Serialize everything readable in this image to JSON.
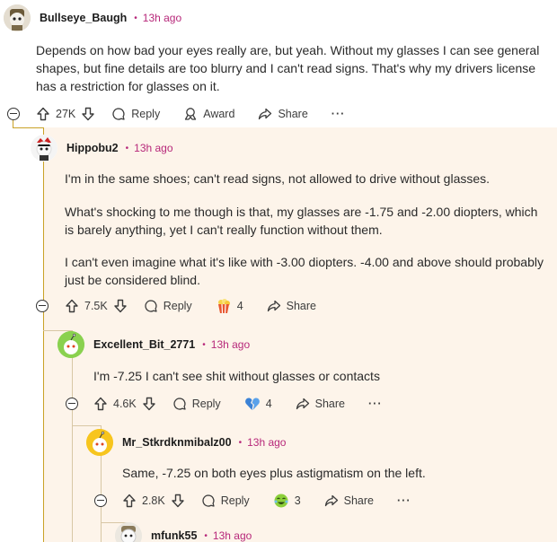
{
  "comments": [
    {
      "user": "Bullseye_Baugh",
      "time": "13h ago",
      "body": "Depends on how bad your eyes really are, but yeah. Without my glasses I can see general shapes, but fine details are too blurry and I can't read signs. That's why my drivers license has a restriction for glasses on it.",
      "votes": "27K",
      "reply_label": "Reply",
      "award_label": "Award",
      "share_label": "Share",
      "more_label": "···"
    },
    {
      "user": "Hippobu2",
      "time": "13h ago",
      "paragraphs": [
        "I'm in the same shoes; can't read signs, not allowed to drive without glasses.",
        "What's shocking to me though is that, my glasses are -1.75 and -2.00 diopters, which is barely anything, yet I can't really function without them.",
        "I can't even imagine what it's like with -3.00 diopters. -4.00 and above should probably just be considered blind."
      ],
      "votes": "7.5K",
      "reply_label": "Reply",
      "award_count": "4",
      "share_label": "Share"
    },
    {
      "user": "Excellent_Bit_2771",
      "time": "13h ago",
      "body": "I'm -7.25 I can't see shit without glasses or contacts",
      "votes": "4.6K",
      "reply_label": "Reply",
      "award_count": "4",
      "share_label": "Share",
      "more_label": "···"
    },
    {
      "user": "Mr_Stkrdknmibalz00",
      "time": "13h ago",
      "body": "Same, -7.25 on both eyes plus astigmatism on the left.",
      "votes": "2.8K",
      "reply_label": "Reply",
      "award_count": "3",
      "share_label": "Share",
      "more_label": "···"
    },
    {
      "user": "mfunk55",
      "time": "13h ago"
    }
  ],
  "colors": {
    "thread_line": "#c9a227",
    "thread_line_inner": "#d8c7a5",
    "panel_bg": "#fdf4ea",
    "accent_pink": "#b7287a"
  },
  "icons": [
    "upvote-icon",
    "downvote-icon",
    "reply-bubble-icon",
    "award-ribbon-icon",
    "share-arrow-icon",
    "collapse-icon",
    "popcorn-award-icon",
    "broken-heart-award-icon",
    "cry-laugh-award-icon"
  ]
}
